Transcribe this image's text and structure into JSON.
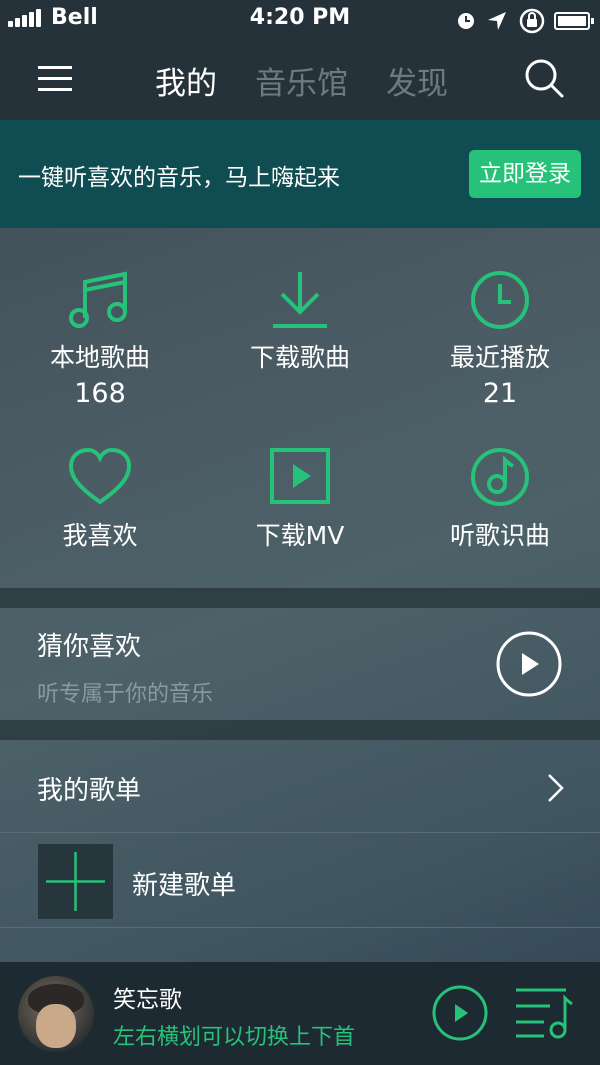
{
  "status_bar": {
    "carrier": "Bell",
    "time": "4:20 PM"
  },
  "nav": {
    "tabs": [
      {
        "label": "我的",
        "active": true
      },
      {
        "label": "音乐馆",
        "active": false
      },
      {
        "label": "发现",
        "active": false
      }
    ],
    "icons": [
      "menu-icon",
      "search-icon"
    ]
  },
  "banner": {
    "text": "一键听喜欢的音乐，马上嗨起来",
    "login_label": "立即登录"
  },
  "shortcuts": [
    {
      "label": "本地歌曲",
      "count": "168",
      "icon": "music-note-icon"
    },
    {
      "label": "下载歌曲",
      "count": "",
      "icon": "download-icon"
    },
    {
      "label": "最近播放",
      "count": "21",
      "icon": "clock-icon"
    },
    {
      "label": "我喜欢",
      "count": "",
      "icon": "heart-icon"
    },
    {
      "label": "下载MV",
      "count": "",
      "icon": "video-play-icon"
    },
    {
      "label": "听歌识曲",
      "count": "",
      "icon": "disc-note-icon"
    }
  ],
  "guess": {
    "title": "猜你喜欢",
    "subtitle": "听专属于你的音乐"
  },
  "playlists": {
    "label": "我的歌单",
    "new_label": "新建歌单"
  },
  "player": {
    "song": "笑忘歌",
    "hint": "左右横划可以切换上下首"
  },
  "colors": {
    "accent": "#27c27a",
    "dark_bar": "#26323a",
    "banner": "#0f4d52"
  }
}
